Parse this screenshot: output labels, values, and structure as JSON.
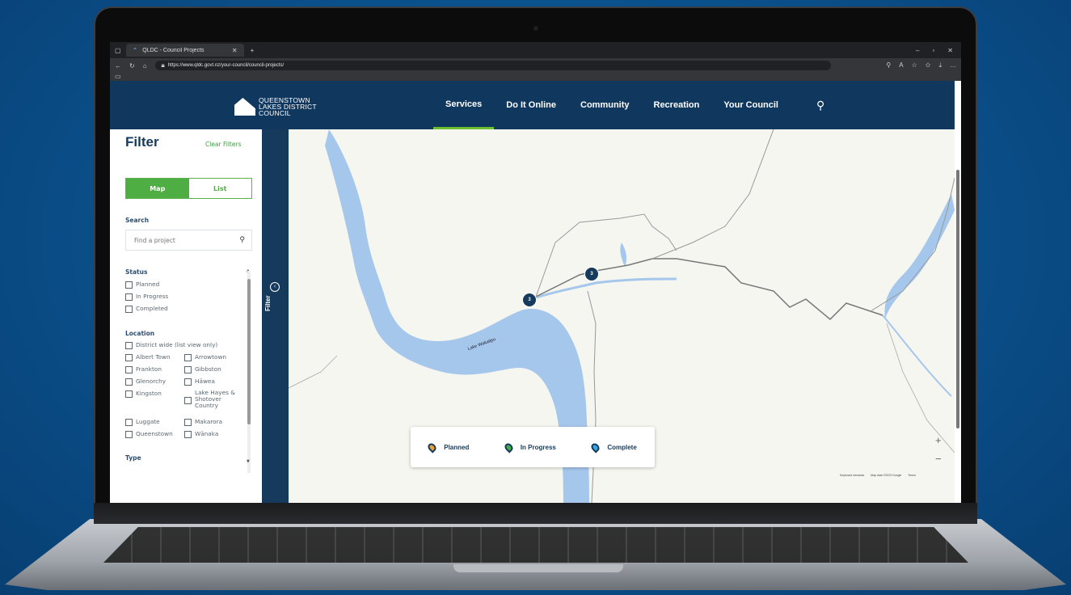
{
  "browser": {
    "tab_title": "QLDC - Council Projects",
    "url": "https://www.qldc.govt.nz/your-council/council-projects/"
  },
  "site": {
    "logo": [
      "QUEENSTOWN",
      "LAKES DISTRICT",
      "COUNCIL"
    ],
    "nav": [
      "Services",
      "Do It Online",
      "Community",
      "Recreation",
      "Your Council"
    ],
    "active_nav": "Services"
  },
  "filter": {
    "title": "Filter",
    "clear_label": "Clear Filters",
    "view_toggle": {
      "map": "Map",
      "list": "List",
      "selected": "Map"
    },
    "search_label": "Search",
    "search_placeholder": "Find a project",
    "status_label": "Status",
    "status_options": [
      "Planned",
      "In Progress",
      "Completed"
    ],
    "location_label": "Location",
    "location_wide": "District wide (list view only)",
    "locations": [
      "Albert Town",
      "Arrowtown",
      "Frankton",
      "Gibbston",
      "Glenorchy",
      "Hāwea",
      "Kingston",
      "Lake Hayes & Shotover Country",
      "Luggate",
      "Makarora",
      "Queenstown",
      "Wānaka"
    ],
    "type_label": "Type",
    "strip_label": "Filter"
  },
  "map": {
    "lake_label": "Lake Wakatipu",
    "clusters": [
      "3",
      "3"
    ],
    "legend": [
      "Planned",
      "In Progress",
      "Complete"
    ],
    "legend_colors": [
      "#e8a13a",
      "#3fae49",
      "#3fa3df"
    ],
    "zoom_in": "+",
    "zoom_out": "−",
    "attribution": [
      "Keyboard shortcuts",
      "Map data ©2023 Google",
      "Terms"
    ]
  },
  "colors": {
    "brand_navy": "#153a5b",
    "brand_green": "#4fae43",
    "water": "#a6c7ec"
  }
}
